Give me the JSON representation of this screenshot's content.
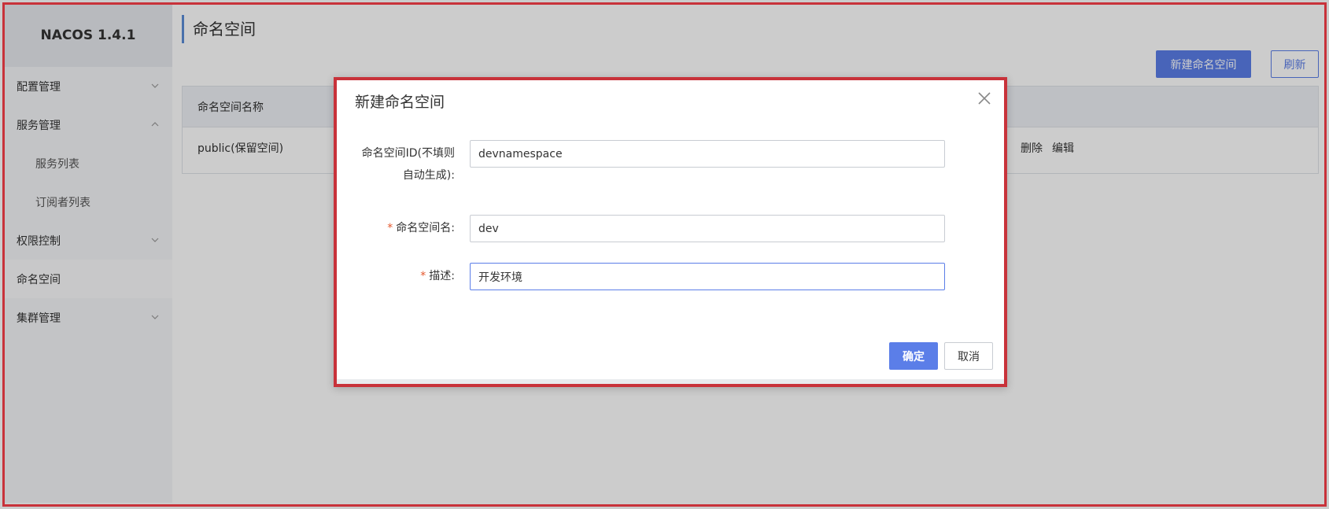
{
  "app": {
    "logo": "NACOS 1.4.1"
  },
  "sidebar": {
    "items": [
      {
        "label": "配置管理",
        "expandable": true,
        "expanded": false
      },
      {
        "label": "服务管理",
        "expandable": true,
        "expanded": true
      },
      {
        "label": "服务列表",
        "sub": true
      },
      {
        "label": "订阅者列表",
        "sub": true
      },
      {
        "label": "权限控制",
        "expandable": true,
        "expanded": false
      },
      {
        "label": "命名空间",
        "active": true
      },
      {
        "label": "集群管理",
        "expandable": true,
        "expanded": false
      }
    ]
  },
  "main": {
    "title": "命名空间",
    "new_button": "新建命名空间",
    "refresh_button": "刷新",
    "table": {
      "header": "命名空间名称",
      "rows": [
        {
          "name": "public(保留空间)",
          "actions": [
            "删除",
            "编辑"
          ]
        }
      ]
    }
  },
  "dialog": {
    "title": "新建命名空间",
    "fields": {
      "id": {
        "label_line1": "命名空间ID(不填则",
        "label_line2": "自动生成):",
        "value": "devnamespace"
      },
      "name": {
        "required_mark": "*",
        "label": "命名空间名:",
        "value": "dev"
      },
      "desc": {
        "required_mark": "*",
        "label": "描述:",
        "value": "开发环境"
      }
    },
    "confirm": "确定",
    "cancel": "取消"
  },
  "colors": {
    "primary": "#5b7ee8",
    "highlight_border": "#c8323a",
    "required": "#e5572c"
  }
}
